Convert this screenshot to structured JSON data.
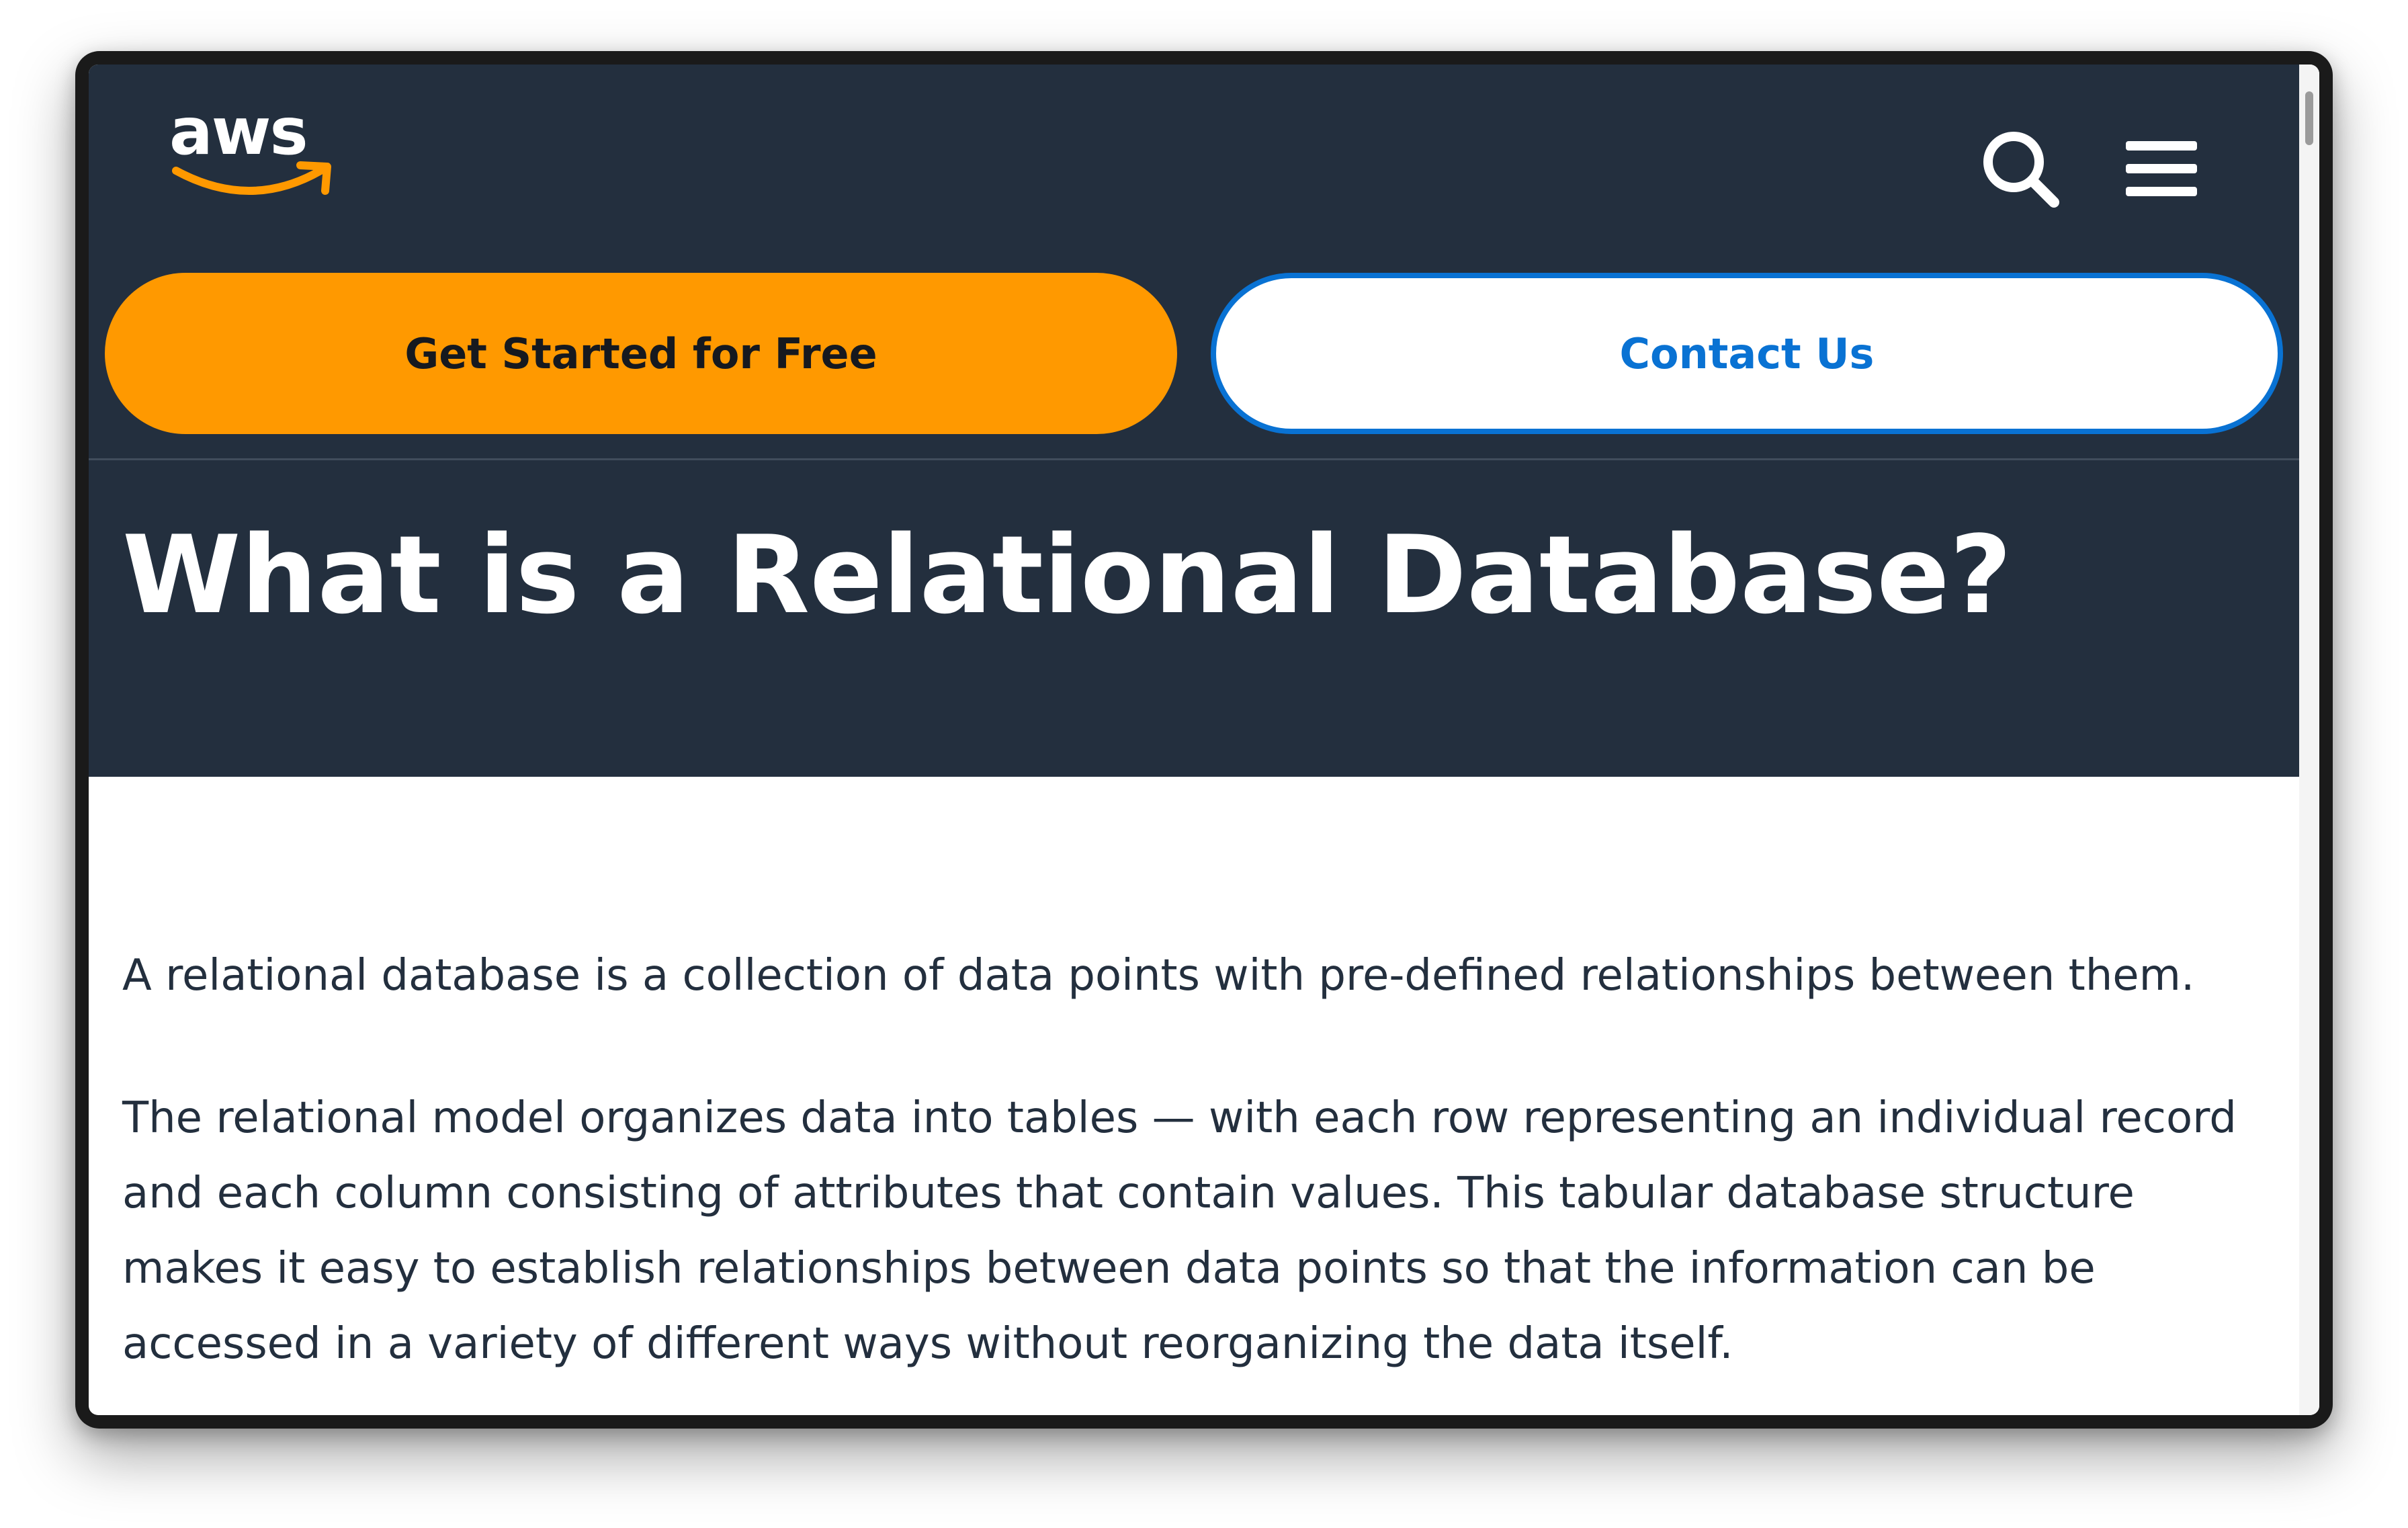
{
  "header": {
    "logo_text": "aws",
    "search_icon": "search-icon",
    "menu_icon": "hamburger-menu-icon"
  },
  "buttons": {
    "get_started": "Get Started for Free",
    "contact_us": "Contact Us"
  },
  "page": {
    "title": "What is a Relational Database?"
  },
  "content": {
    "paragraphs": [
      "A relational database is a collection of data points with pre-defined relationships between them.",
      "The relational model organizes data into tables — with each row representing an individual record and each column consisting of attributes that contain values. This tabular database structure makes it easy to establish relationships between data points so that the information can be accessed in a variety of different ways without reorganizing the data itself."
    ]
  },
  "colors": {
    "header_bg": "#232f3e",
    "primary_button": "#ff9900",
    "link_blue": "#0972d3",
    "body_text": "#232f3e"
  }
}
